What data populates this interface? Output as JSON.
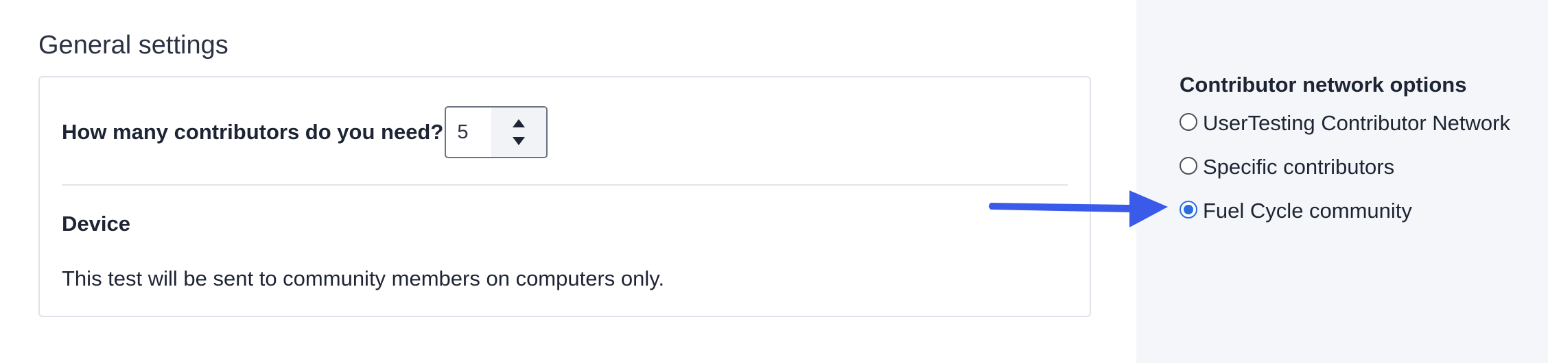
{
  "general": {
    "title": "General settings",
    "contributors_label": "How many contributors do you need?",
    "contributors_value": "5",
    "device_heading": "Device",
    "device_text": "This test will be sent to community members on computers only."
  },
  "network": {
    "title": "Contributor network options",
    "options": [
      {
        "label": "UserTesting Contributor Network",
        "selected": false
      },
      {
        "label": "Specific contributors",
        "selected": false
      },
      {
        "label": "Fuel Cycle community",
        "selected": true
      }
    ]
  },
  "colors": {
    "accent": "#2b6de0",
    "arrow": "#3a5bea",
    "side_panel_bg": "#f4f6f9"
  },
  "icons": {
    "stepper_up": "triangle-up",
    "stepper_down": "triangle-down",
    "annotation": "arrow-right"
  }
}
